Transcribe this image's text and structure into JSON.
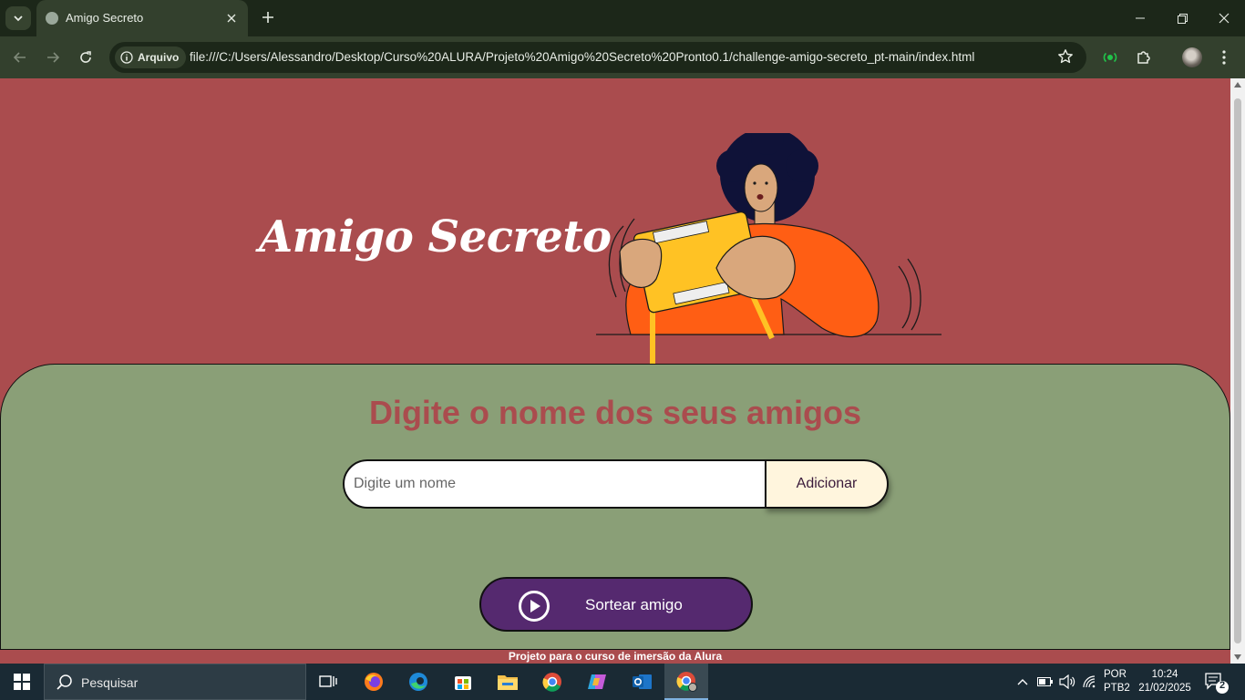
{
  "browser": {
    "tab_title": "Amigo Secreto",
    "site_chip_label": "Arquivo",
    "url": "file:///C:/Users/Alessandro/Desktop/Curso%20ALURA/Projeto%20Amigo%20Secreto%20Pronto0.1/challenge-amigo-secreto_pt-main/index.html"
  },
  "page": {
    "title": "Amigo Secreto",
    "section_title": "Digite o nome dos seus amigos",
    "input": {
      "placeholder": "Digite um nome",
      "value": ""
    },
    "add_button_label": "Adicionar",
    "draw_button_label": "Sortear amigo",
    "footer_text": "Projeto para o curso de imersão da Alura",
    "colors": {
      "background": "#aa4c4e",
      "card": "#8a9f77",
      "draw_button": "#55296f",
      "add_button": "#fff5dd"
    }
  },
  "taskbar": {
    "search_placeholder": "Pesquisar",
    "apps": [
      "task-view",
      "firefox",
      "edge",
      "microsoft-store",
      "file-explorer",
      "chrome",
      "copilot",
      "outlook",
      "chrome-profile"
    ],
    "language_line1": "POR",
    "language_line2": "PTB2",
    "time": "10:24",
    "date": "21/02/2025",
    "notification_count": "2"
  }
}
